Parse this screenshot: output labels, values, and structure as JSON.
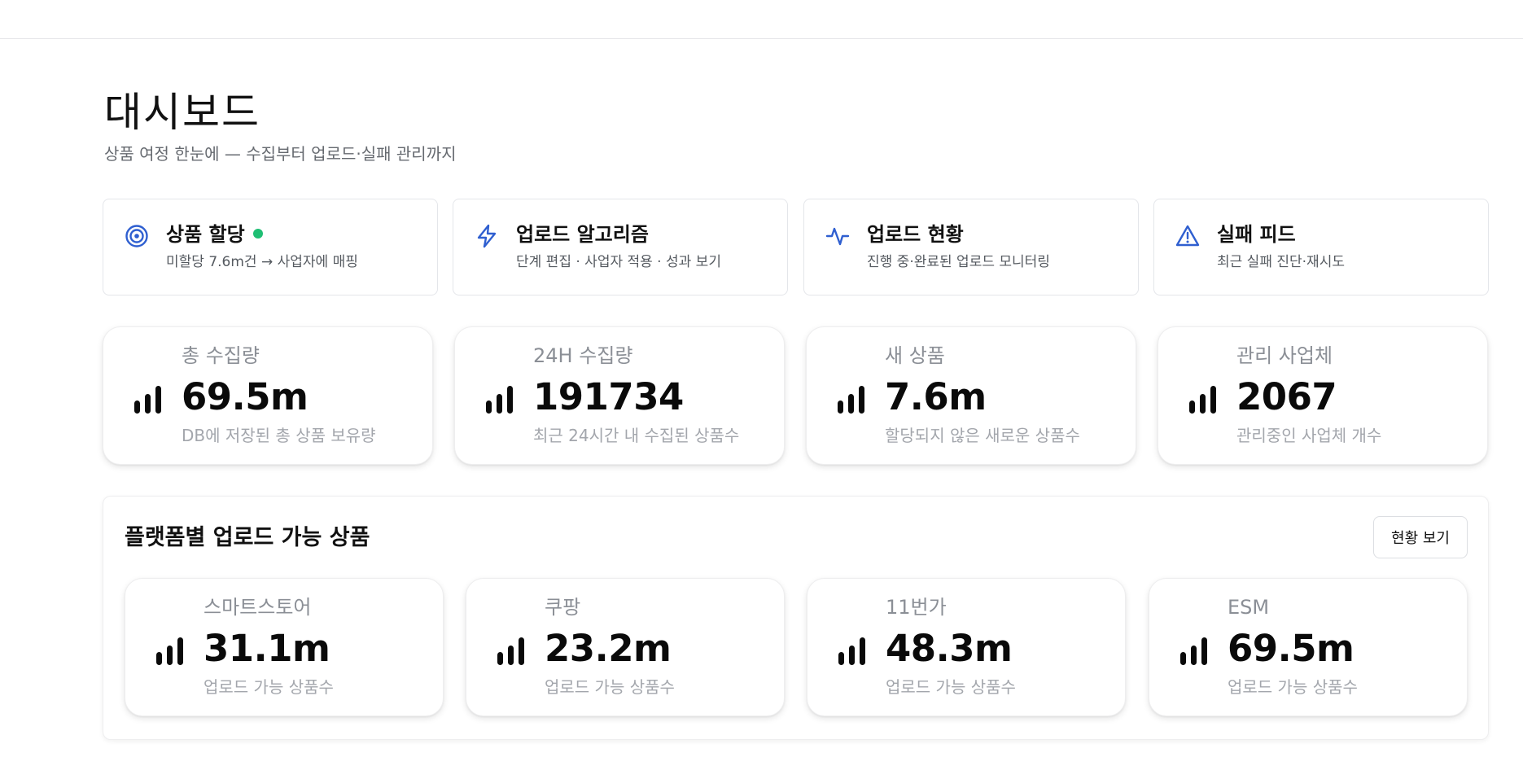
{
  "page": {
    "title": "대시보드",
    "subtitle": "상품 여정 한눈에 — 수집부터 업로드·실패 관리까지"
  },
  "nav_cards": [
    {
      "title": "상품 할당",
      "description": "미할당 7.6m건 → 사업자에 매핑",
      "icon": "target-icon",
      "status": "active"
    },
    {
      "title": "업로드 알고리즘",
      "description": "단계 편집 · 사업자 적용 · 성과 보기",
      "icon": "lightning-icon"
    },
    {
      "title": "업로드 현황",
      "description": "진행 중·완료된 업로드 모니터링",
      "icon": "activity-icon"
    },
    {
      "title": "실패 피드",
      "description": "최근 실패 진단·재시도",
      "icon": "warning-icon"
    }
  ],
  "stats": [
    {
      "label": "총 수집량",
      "value": "69.5m",
      "description": "DB에 저장된 총 상품 보유량",
      "icon": "signal-bars-icon"
    },
    {
      "label": "24H 수집량",
      "value": "191734",
      "description": "최근 24시간 내 수집된 상품수",
      "icon": "signal-bars-icon"
    },
    {
      "label": "새 상품",
      "value": "7.6m",
      "description": "할당되지 않은 새로운 상품수",
      "icon": "signal-bars-icon"
    },
    {
      "label": "관리 사업체",
      "value": "2067",
      "description": "관리중인 사업체 개수",
      "icon": "signal-bars-icon"
    }
  ],
  "platform_panel": {
    "title": "플랫폼별 업로드 가능 상품",
    "button_label": "현황 보기",
    "platforms": [
      {
        "label": "스마트스토어",
        "value": "31.1m",
        "description": "업로드 가능 상품수",
        "icon": "signal-bars-icon"
      },
      {
        "label": "쿠팡",
        "value": "23.2m",
        "description": "업로드 가능 상품수",
        "icon": "signal-bars-icon"
      },
      {
        "label": "11번가",
        "value": "48.3m",
        "description": "업로드 가능 상품수",
        "icon": "signal-bars-icon"
      },
      {
        "label": "ESM",
        "value": "69.5m",
        "description": "업로드 가능 상품수",
        "icon": "signal-bars-icon"
      }
    ]
  },
  "colors": {
    "accent": "#2f5fd0",
    "status_ok": "#1fbf74",
    "muted_text": "#8b8f96"
  }
}
